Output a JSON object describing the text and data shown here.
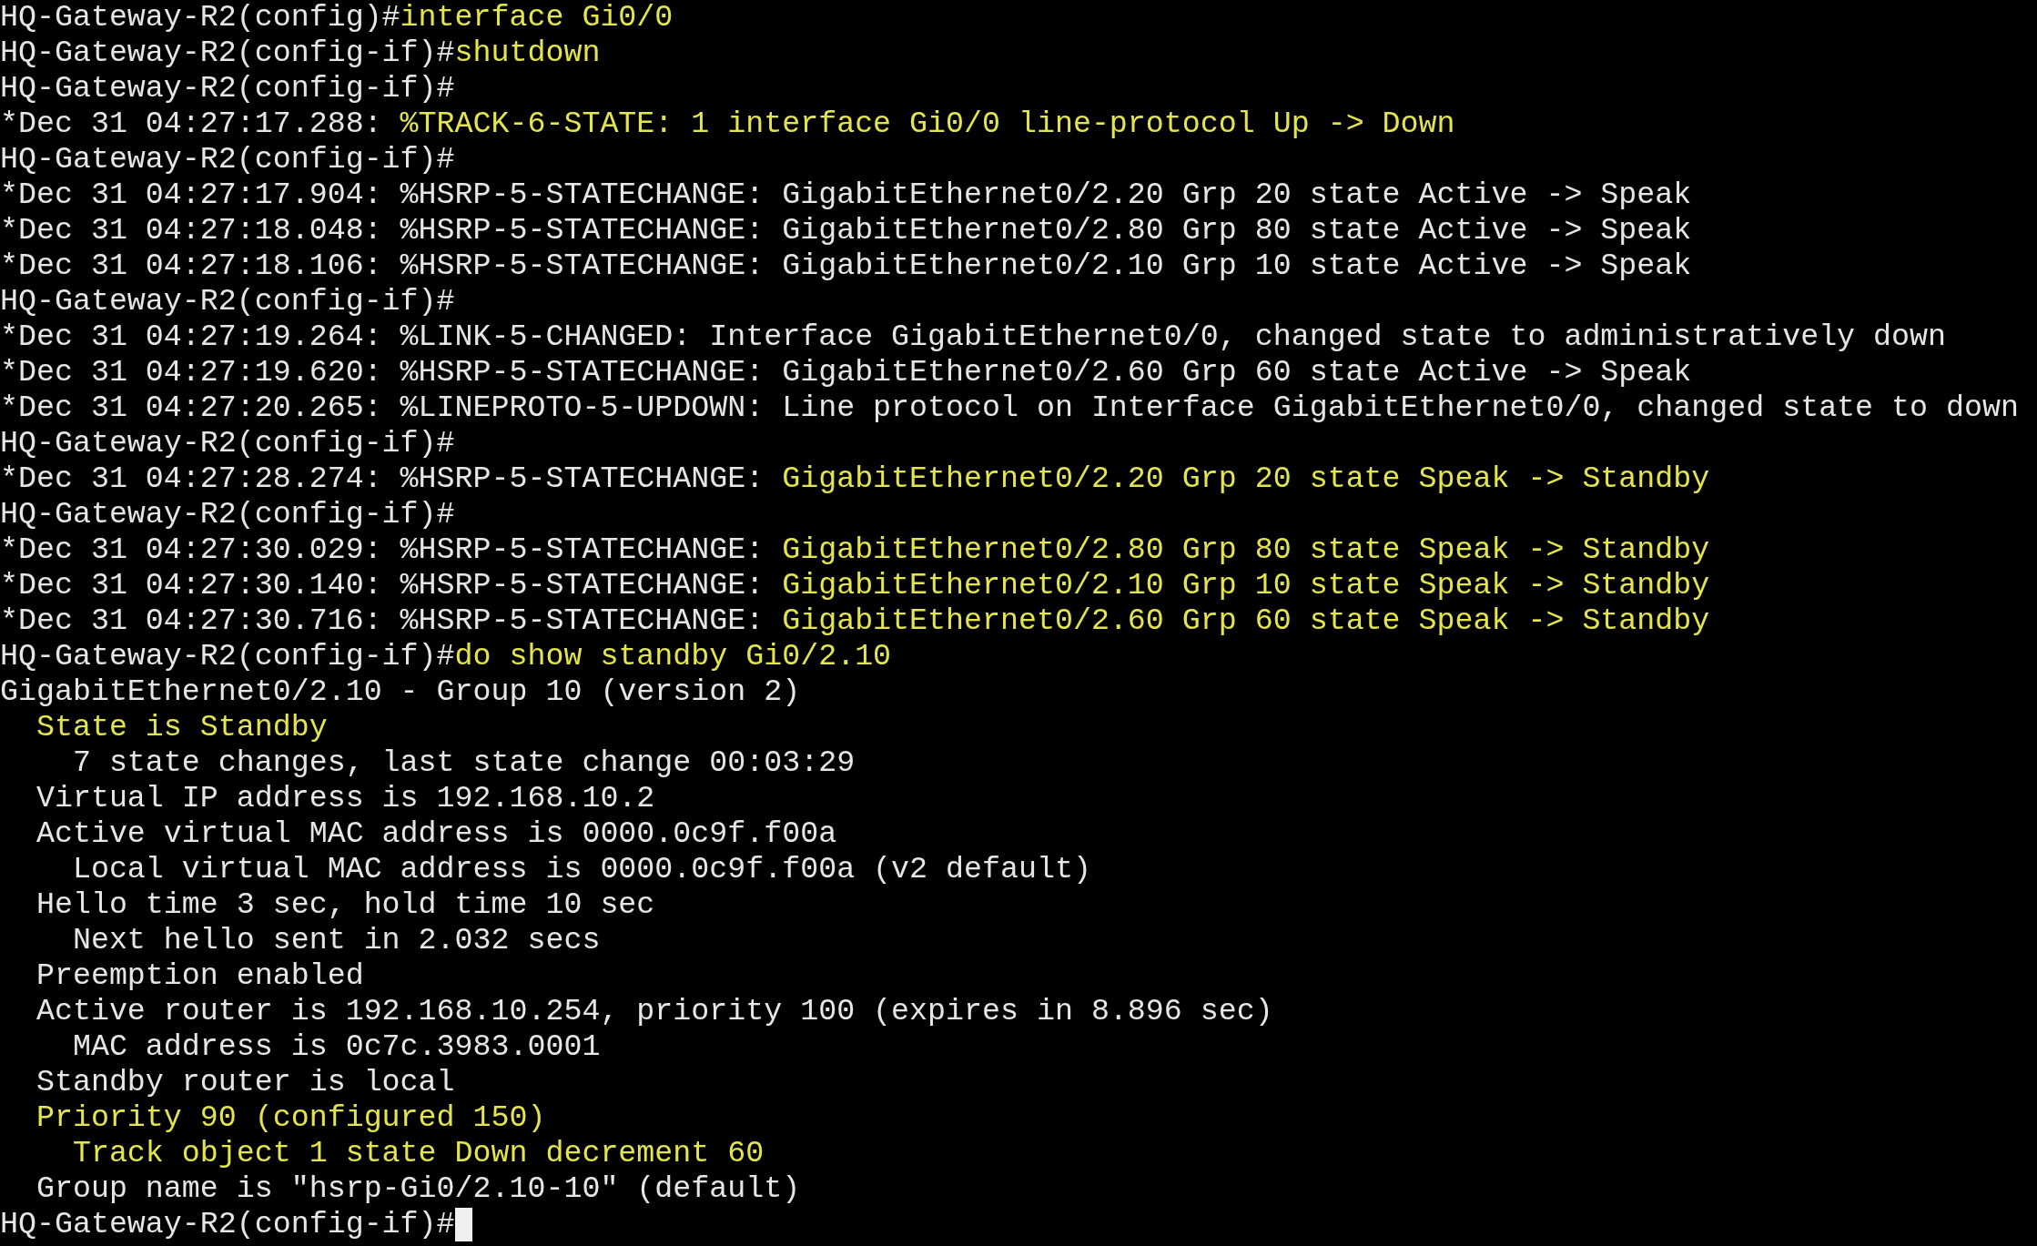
{
  "terminal": {
    "lines": [
      [
        {
          "text": "HQ-Gateway-R2(config)#",
          "kind": "normal"
        },
        {
          "text": "interface Gi0/0",
          "kind": "highlight"
        }
      ],
      [
        {
          "text": "HQ-Gateway-R2(config-if)#",
          "kind": "normal"
        },
        {
          "text": "shutdown",
          "kind": "highlight"
        }
      ],
      [
        {
          "text": "HQ-Gateway-R2(config-if)#",
          "kind": "normal"
        }
      ],
      [
        {
          "text": "*Dec 31 04:27:17.288: ",
          "kind": "normal"
        },
        {
          "text": "%TRACK-6-STATE: 1 interface Gi0/0 line-protocol Up -> Down",
          "kind": "highlight"
        }
      ],
      [
        {
          "text": "HQ-Gateway-R2(config-if)#",
          "kind": "normal"
        }
      ],
      [
        {
          "text": "*Dec 31 04:27:17.904: %HSRP-5-STATECHANGE: GigabitEthernet0/2.20 Grp 20 state Active -> Speak",
          "kind": "normal"
        }
      ],
      [
        {
          "text": "*Dec 31 04:27:18.048: %HSRP-5-STATECHANGE: GigabitEthernet0/2.80 Grp 80 state Active -> Speak",
          "kind": "normal"
        }
      ],
      [
        {
          "text": "*Dec 31 04:27:18.106: %HSRP-5-STATECHANGE: GigabitEthernet0/2.10 Grp 10 state Active -> Speak",
          "kind": "normal"
        }
      ],
      [
        {
          "text": "HQ-Gateway-R2(config-if)#",
          "kind": "normal"
        }
      ],
      [
        {
          "text": "*Dec 31 04:27:19.264: %LINK-5-CHANGED: Interface GigabitEthernet0/0, changed state to administratively down",
          "kind": "normal"
        }
      ],
      [
        {
          "text": "*Dec 31 04:27:19.620: %HSRP-5-STATECHANGE: GigabitEthernet0/2.60 Grp 60 state Active -> Speak",
          "kind": "normal"
        }
      ],
      [
        {
          "text": "*Dec 31 04:27:20.265: %LINEPROTO-5-UPDOWN: Line protocol on Interface GigabitEthernet0/0, changed state to down",
          "kind": "normal"
        }
      ],
      [
        {
          "text": "HQ-Gateway-R2(config-if)#",
          "kind": "normal"
        }
      ],
      [
        {
          "text": "*Dec 31 04:27:28.274: %HSRP-5-STATECHANGE: ",
          "kind": "normal"
        },
        {
          "text": "GigabitEthernet0/2.20 Grp 20 state Speak -> Standby",
          "kind": "highlight"
        }
      ],
      [
        {
          "text": "HQ-Gateway-R2(config-if)#",
          "kind": "normal"
        }
      ],
      [
        {
          "text": "*Dec 31 04:27:30.029: %HSRP-5-STATECHANGE: ",
          "kind": "normal"
        },
        {
          "text": "GigabitEthernet0/2.80 Grp 80 state Speak -> Standby",
          "kind": "highlight"
        }
      ],
      [
        {
          "text": "*Dec 31 04:27:30.140: %HSRP-5-STATECHANGE: ",
          "kind": "normal"
        },
        {
          "text": "GigabitEthernet0/2.10 Grp 10 state Speak -> Standby",
          "kind": "highlight"
        }
      ],
      [
        {
          "text": "*Dec 31 04:27:30.716: %HSRP-5-STATECHANGE: ",
          "kind": "normal"
        },
        {
          "text": "GigabitEthernet0/2.60 Grp 60 state Speak -> Standby",
          "kind": "highlight"
        }
      ],
      [
        {
          "text": "HQ-Gateway-R2(config-if)#",
          "kind": "normal"
        },
        {
          "text": "do show standby Gi0/2.10",
          "kind": "highlight"
        }
      ],
      [
        {
          "text": "GigabitEthernet0/2.10 - Group 10 (version 2)",
          "kind": "normal"
        }
      ],
      [
        {
          "text": "  State is Standby",
          "kind": "highlight"
        }
      ],
      [
        {
          "text": "    7 state changes, last state change 00:03:29",
          "kind": "normal"
        }
      ],
      [
        {
          "text": "  Virtual IP address is 192.168.10.2",
          "kind": "normal"
        }
      ],
      [
        {
          "text": "  Active virtual MAC address is 0000.0c9f.f00a",
          "kind": "normal"
        }
      ],
      [
        {
          "text": "    Local virtual MAC address is 0000.0c9f.f00a (v2 default)",
          "kind": "normal"
        }
      ],
      [
        {
          "text": "  Hello time 3 sec, hold time 10 sec",
          "kind": "normal"
        }
      ],
      [
        {
          "text": "    Next hello sent in 2.032 secs",
          "kind": "normal"
        }
      ],
      [
        {
          "text": "  Preemption enabled",
          "kind": "normal"
        }
      ],
      [
        {
          "text": "  Active router is 192.168.10.254, priority 100 (expires in 8.896 sec)",
          "kind": "normal"
        }
      ],
      [
        {
          "text": "    MAC address is 0c7c.3983.0001",
          "kind": "normal"
        }
      ],
      [
        {
          "text": "  Standby router is local",
          "kind": "normal"
        }
      ],
      [
        {
          "text": "  Priority 90 (configured 150)",
          "kind": "highlight"
        }
      ],
      [
        {
          "text": "    Track object 1 state Down decrement 60",
          "kind": "highlight"
        }
      ],
      [
        {
          "text": "  Group name is \"hsrp-Gi0/2.10-10\" (default)",
          "kind": "normal"
        }
      ],
      [
        {
          "text": "HQ-Gateway-R2(config-if)#",
          "kind": "normal"
        }
      ]
    ],
    "cursor": true
  }
}
